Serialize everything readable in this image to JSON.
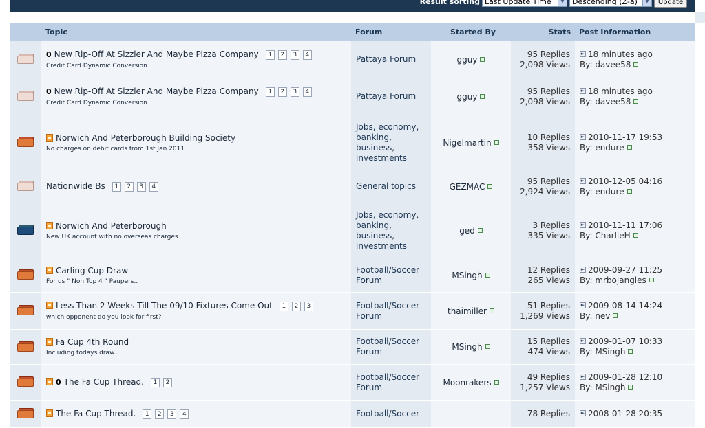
{
  "sort_bar": {
    "label": "Result sorting",
    "sort_field": "Last Update Time",
    "sort_order": "Descending (Z-a)",
    "update_label": "Update"
  },
  "columns": {
    "topic": "Topic",
    "forum": "Forum",
    "started_by": "Started By",
    "stats": "Stats",
    "post_info": "Post Information"
  },
  "topics": [
    {
      "title": "New Rip-Off At Sizzler And Maybe Pizza Company",
      "desc": "Credit Card Dynamic Conversion",
      "pages": [
        "1",
        "2",
        "3",
        "4"
      ],
      "forum": "Pattaya Forum",
      "starter": "gguy",
      "replies": "95 Replies",
      "views": "2,098 Views",
      "last": "18 minutes ago",
      "by": "By: davee58"
    },
    {
      "title": "New Rip-Off At Sizzler And Maybe Pizza Company",
      "desc": "Credit Card Dynamic Conversion",
      "pages": [
        "1",
        "2",
        "3",
        "4"
      ],
      "forum": "Pattaya Forum",
      "starter": "gguy",
      "replies": "95 Replies",
      "views": "2,098 Views",
      "last": "18 minutes ago",
      "by": "By: davee58"
    },
    {
      "title": "Norwich And Peterborough Building Society",
      "desc": "No charges on debit cards from 1st Jan 2011",
      "pages": [],
      "forum": "Jobs, economy, banking, business, investments",
      "starter": "Nigelmartin",
      "replies": "10 Replies",
      "views": "358 Views",
      "last": "2010-11-17 19:53",
      "by": "By: endure"
    },
    {
      "title": "Nationwide Bs",
      "desc": "",
      "pages": [
        "1",
        "2",
        "3",
        "4"
      ],
      "forum": "General topics",
      "starter": "GEZMAC",
      "replies": "95 Replies",
      "views": "2,924 Views",
      "last": "2010-12-05 04:16",
      "by": "By: endure"
    },
    {
      "title": "Norwich And Peterborough",
      "desc": "New UK account with no overseas charges",
      "pages": [],
      "forum": "Jobs, economy, banking, business, investments",
      "starter": "ged",
      "replies": "3 Replies",
      "views": "335 Views",
      "last": "2010-11-11 17:06",
      "by": "By: CharlieH"
    },
    {
      "title": "Carling Cup Draw",
      "desc": "For us \" Non Top 4 \" Paupers..",
      "pages": [],
      "forum": "Football/Soccer Forum",
      "starter": "MSingh",
      "replies": "12 Replies",
      "views": "265 Views",
      "last": "2009-09-27 11:25",
      "by": "By: mrbojangles"
    },
    {
      "title": "Less Than 2 Weeks Till The 09/10 Fixtures Come Out",
      "desc": "which opponent do you look for first?",
      "pages": [
        "1",
        "2",
        "3"
      ],
      "forum": "Football/Soccer Forum",
      "starter": "thaimiller",
      "replies": "51 Replies",
      "views": "1,269 Views",
      "last": "2009-08-14 14:24",
      "by": "By: nev"
    },
    {
      "title": "Fa Cup 4th Round",
      "desc": "Including todays draw..",
      "pages": [],
      "forum": "Football/Soccer Forum",
      "starter": "MSingh",
      "replies": "15 Replies",
      "views": "474 Views",
      "last": "2009-01-07 10:33",
      "by": "By: MSingh"
    },
    {
      "title": "The Fa Cup Thread.",
      "desc": "",
      "pages": [
        "1",
        "2"
      ],
      "forum": "Football/Soccer Forum",
      "starter": "Moonrakers",
      "replies": "49 Replies",
      "views": "1,257 Views",
      "last": "2009-01-28 12:10",
      "by": "By: MSingh"
    },
    {
      "title": "The Fa Cup Thread.",
      "desc": "",
      "pages": [
        "1",
        "2",
        "3",
        "4"
      ],
      "forum": "Football/Soccer",
      "starter": "",
      "replies": "78 Replies",
      "views": "",
      "last": "2008-01-28 20:35",
      "by": ""
    }
  ]
}
